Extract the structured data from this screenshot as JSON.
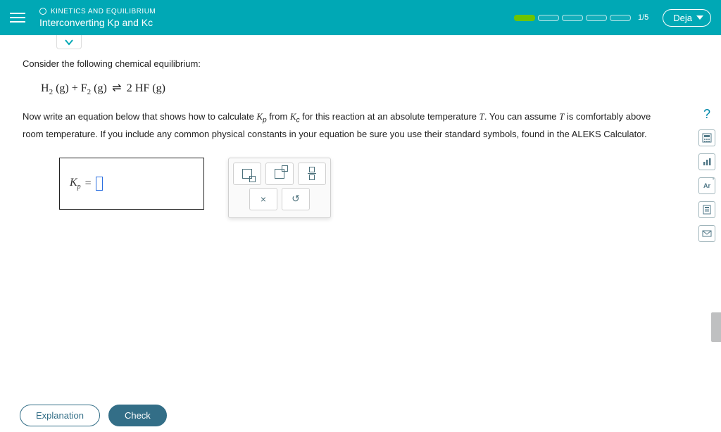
{
  "header": {
    "topic": "KINETICS AND EQUILIBRIUM",
    "subtopic": "Interconverting Kp and Kc",
    "progress_label": "1/5",
    "progress_segments": 5,
    "progress_filled": 1,
    "user": "Deja"
  },
  "question": {
    "intro": "Consider the following chemical equilibrium:",
    "equation": "H₂ (g) + F₂ (g) ⇌ 2 HF (g)",
    "prompt_pre": "Now write an equation below that shows how to calculate ",
    "kp": "K",
    "kp_sub": "p",
    "prompt_mid1": " from ",
    "kc": "K",
    "kc_sub": "c",
    "prompt_mid2": " for this reaction at an absolute temperature ",
    "T": "T",
    "prompt_post": ". You can assume ",
    "prompt_end": " is comfortably above room temperature. If you include any common physical constants in your equation be sure you use their standard symbols, found in the ALEKS Calculator."
  },
  "answer": {
    "lhs_var": "K",
    "lhs_sub": "p",
    "equals": "="
  },
  "palette": {
    "clear": "×",
    "reset": "↺"
  },
  "side": {
    "help": "?",
    "ar_label": "Ar"
  },
  "footer": {
    "explanation": "Explanation",
    "check": "Check"
  }
}
